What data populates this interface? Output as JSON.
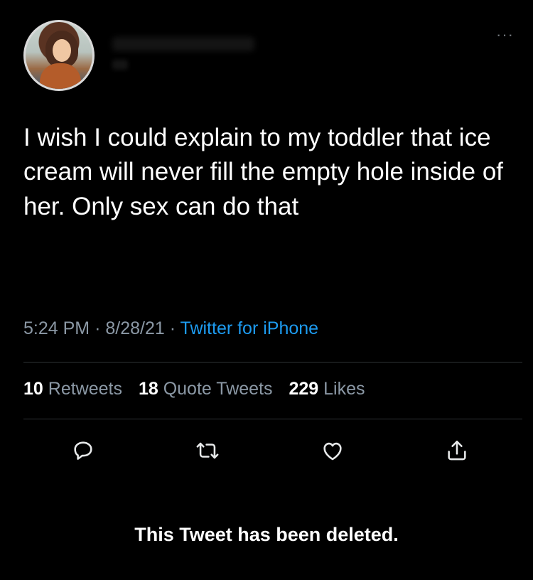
{
  "tweet": {
    "text": "I wish I could explain to my toddler that ice cream will never fill the empty hole inside of her. Only sex can do that",
    "time": "5:24 PM",
    "date": "8/28/21",
    "source": "Twitter for iPhone"
  },
  "stats": {
    "retweets_count": "10",
    "retweets_label": "Retweets",
    "quotes_count": "18",
    "quotes_label": "Quote Tweets",
    "likes_count": "229",
    "likes_label": "Likes"
  },
  "icons": {
    "more": "more-options-icon",
    "reply": "reply-icon",
    "retweet": "retweet-icon",
    "like": "like-icon",
    "share": "share-icon"
  },
  "more_glyph": "···",
  "footer": {
    "deleted_notice": "This Tweet has been deleted."
  },
  "colors": {
    "background": "#000000",
    "text": "#ffffff",
    "secondary": "#8b98a5",
    "link": "#1d9bf0"
  }
}
